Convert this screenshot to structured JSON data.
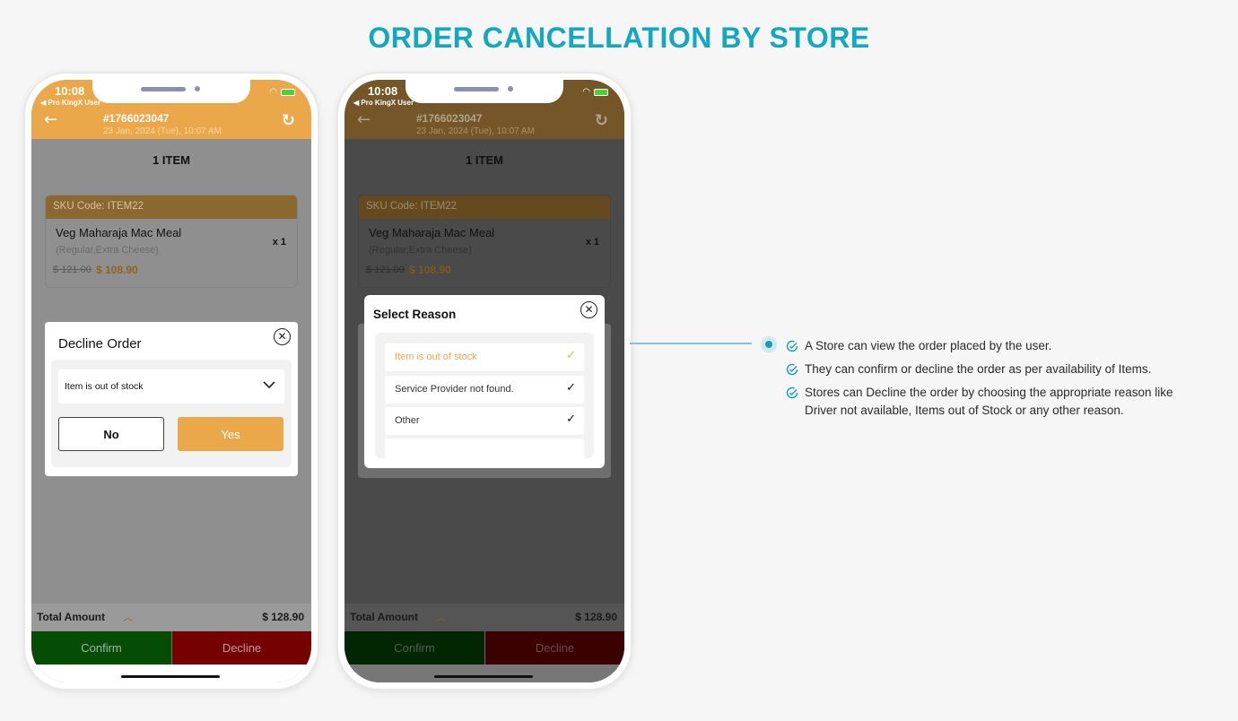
{
  "page": {
    "title": "ORDER CANCELLATION BY STORE"
  },
  "phones": [
    {
      "status": {
        "time": "10:08",
        "back_app": "◀ Pro KingX User"
      },
      "header": {
        "order_number": "#1766023047",
        "order_date": "23 Jan, 2024 (Tue),  10:07 AM"
      },
      "item_count": "1 ITEM",
      "item": {
        "sku": "SKU Code: ITEM22",
        "name": "Veg Maharaja Mac Meal",
        "options": "(Regular,Extra Cheese)",
        "quantity": "x 1",
        "original_price": "$ 121.00",
        "price": "$ 108.90"
      },
      "total": {
        "label": "Total Amount",
        "value": "$ 128.90"
      },
      "actions": {
        "confirm": "Confirm",
        "decline": "Decline"
      },
      "decline_modal": {
        "title": "Decline Order",
        "selected_reason": "Item is out of stock",
        "no_label": "No",
        "yes_label": "Yes"
      }
    },
    {
      "status": {
        "time": "10:08",
        "back_app": "◀ Pro KingX User"
      },
      "header": {
        "order_number": "#1766023047",
        "order_date": "23 Jan, 2024 (Tue),  10:07 AM"
      },
      "item_count": "1 ITEM",
      "item": {
        "sku": "SKU Code: ITEM22",
        "name": "Veg Maharaja Mac Meal",
        "options": "(Regular,Extra Cheese)",
        "quantity": "x 1",
        "original_price": "$ 121.00",
        "price": "$ 108.90"
      },
      "total": {
        "label": "Total Amount",
        "value": "$ 128.90"
      },
      "actions": {
        "confirm": "Confirm",
        "decline": "Decline"
      },
      "reason_modal": {
        "title": "Select Reason",
        "reasons": [
          {
            "label": "Item is out of stock",
            "selected": true
          },
          {
            "label": "Service Provider not found.",
            "selected": false
          },
          {
            "label": "Other",
            "selected": false
          }
        ]
      }
    }
  ],
  "annotation": {
    "bullets": [
      "A Store can view the order placed by the user.",
      "They can confirm or decline the order as per availability of Items.",
      "Stores can Decline the order by choosing the appropriate reason like Driver not available, Items out of Stock or any other reason."
    ]
  },
  "colors": {
    "title": "#12a8bf",
    "brand_orange": "#eba84b",
    "confirm_green": "#054d05",
    "decline_red": "#750101",
    "accent_teal": "#1b9ab7"
  }
}
